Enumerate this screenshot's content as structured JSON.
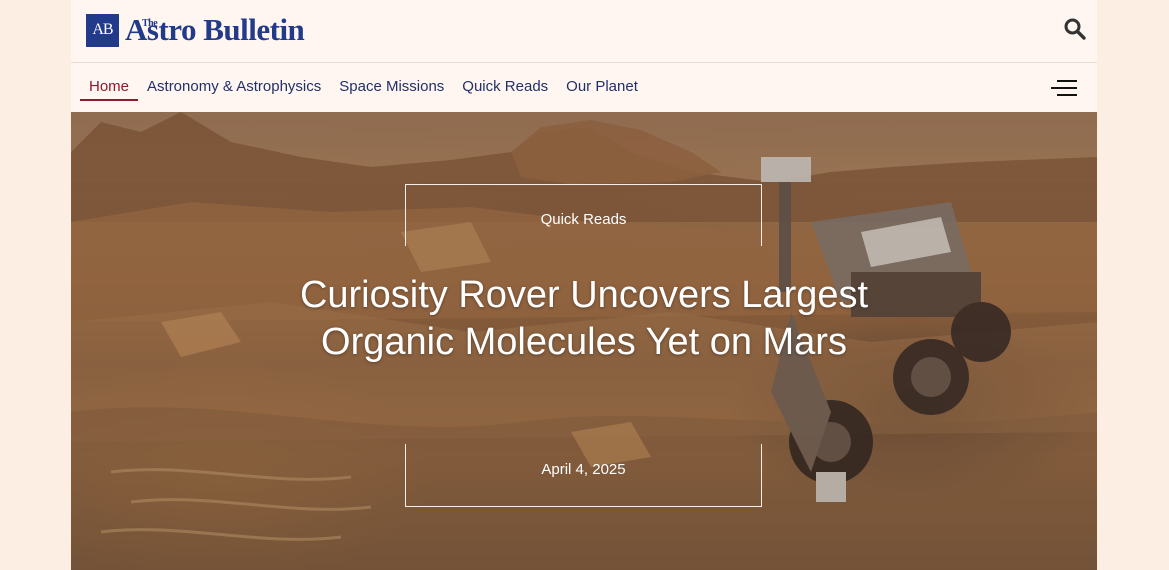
{
  "header": {
    "logo_mark": "AB",
    "logo_the": "The",
    "logo_name": "Astro Bulletin"
  },
  "nav": {
    "items": [
      {
        "label": "Home",
        "active": true
      },
      {
        "label": "Astronomy & Astrophysics",
        "active": false
      },
      {
        "label": "Space Missions",
        "active": false
      },
      {
        "label": "Quick Reads",
        "active": false
      },
      {
        "label": "Our Planet",
        "active": false
      }
    ]
  },
  "hero": {
    "category": "Quick Reads",
    "headline": "Curiosity Rover Uncovers Largest Organic Molecules Yet on Mars",
    "date": "April 4, 2025"
  },
  "icons": {
    "search": "search-icon",
    "menu": "hamburger-menu-icon"
  },
  "colors": {
    "brand": "#213a8a",
    "nav_text": "#22306a",
    "active": "#8a1b2e",
    "page_bg": "#fdeee3",
    "header_bg": "#fff6f1"
  }
}
